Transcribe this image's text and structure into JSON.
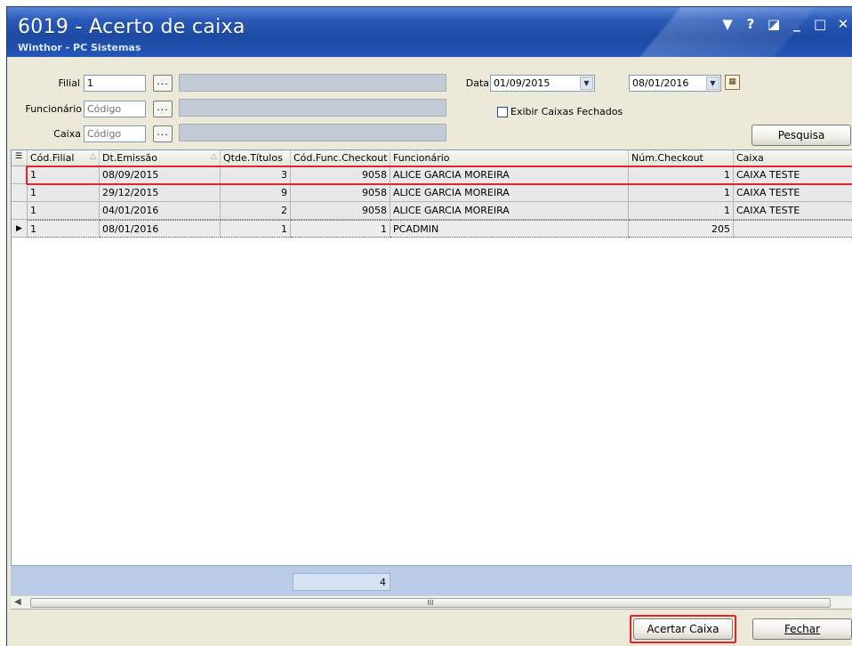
{
  "window": {
    "title": "6019 - Acerto de caixa",
    "subtitle": "Winthor - PC Sistemas",
    "controls": [
      "▼",
      "?",
      "◪",
      "_",
      "□",
      "✕"
    ]
  },
  "filters": {
    "filial_label": "Filial",
    "filial_value": "1",
    "funcionario_label": "Funcionário",
    "funcionario_placeholder": "Código",
    "caixa_label": "Caixa",
    "caixa_placeholder": "Código",
    "lookup_button": "...",
    "data_label": "Data",
    "data_start": "01/09/2015",
    "data_end": "08/01/2016",
    "exibir_caixas_fechados": "Exibir Caixas Fechados",
    "pesquisa_button": "Pesquisa"
  },
  "grid": {
    "columns": [
      "Cód.Filial",
      "Dt.Emissão",
      "Qtde.Títulos",
      "Cód.Func.Checkout",
      "Funcionário",
      "Núm.Checkout",
      "Caixa"
    ],
    "rows": [
      {
        "filial": "1",
        "emissao": "08/09/2015",
        "qtde": "3",
        "func": "9058",
        "funcionario": "ALICE GARCIA MOREIRA",
        "checkout": "1",
        "caixa": "CAIXA TESTE"
      },
      {
        "filial": "1",
        "emissao": "29/12/2015",
        "qtde": "9",
        "func": "9058",
        "funcionario": "ALICE GARCIA MOREIRA",
        "checkout": "1",
        "caixa": "CAIXA TESTE"
      },
      {
        "filial": "1",
        "emissao": "04/01/2016",
        "qtde": "2",
        "func": "9058",
        "funcionario": "ALICE GARCIA MOREIRA",
        "checkout": "1",
        "caixa": "CAIXA TESTE"
      },
      {
        "filial": "1",
        "emissao": "08/01/2016",
        "qtde": "1",
        "func": "1",
        "funcionario": "PCADMIN",
        "checkout": "205",
        "caixa": ""
      }
    ],
    "footer_total": "4",
    "scroll_thumb": "III"
  },
  "actions": {
    "acertar_caixa": "Acertar Caixa",
    "fechar": "Fechar"
  },
  "colors": {
    "title_blue": "#1c49a3",
    "highlight_red": "#e0262b",
    "footer_blue": "#b9cbe6"
  }
}
